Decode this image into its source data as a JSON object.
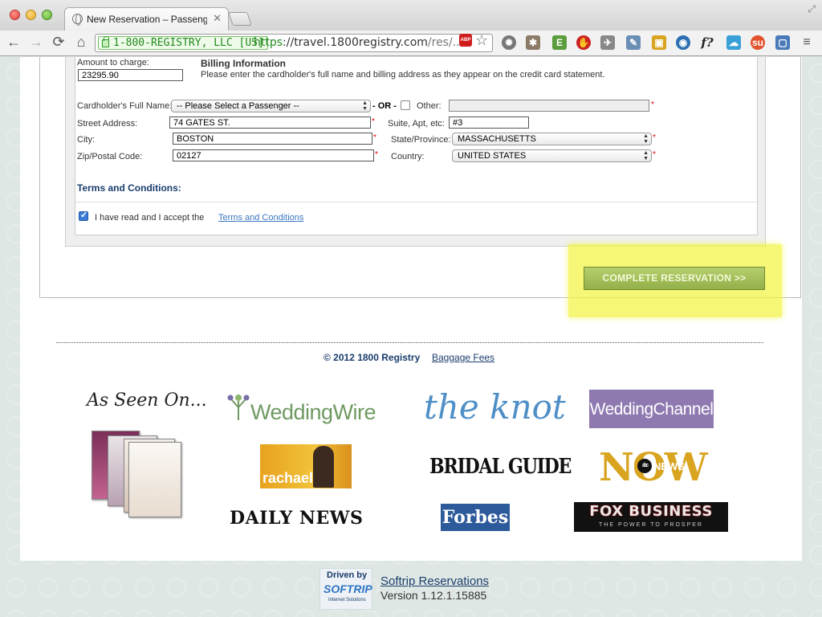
{
  "browser": {
    "tab_title": "New Reservation – Passenger",
    "tab_close": "✕",
    "ev_certificate": "1-800-REGISTRY, LLC [US]",
    "url_scheme": "https",
    "url_rest": "://travel.1800registry.com",
    "url_path": "/res/...",
    "back_icon": "←",
    "forward_icon": "→",
    "reload_icon": "⟳",
    "home_icon": "⌂",
    "bookmark_icon": "☆",
    "abp_label": "ABP"
  },
  "form": {
    "amount_label": "Amount to charge:",
    "amount_value": "23295.90",
    "billing_title": "Billing Information",
    "billing_desc": "Please enter the cardholder's full name and billing address as they appear on the credit card statement.",
    "cardholder_label": "Cardholder's Full Name:",
    "passenger_select": "-- Please Select a Passenger --",
    "or_text": "- OR -",
    "other_label": "Other:",
    "other_value": "",
    "street_label": "Street Address:",
    "street_value": "74 GATES ST.",
    "suite_label": "Suite, Apt, etc:",
    "suite_value": "#3",
    "city_label": "City:",
    "city_value": "BOSTON",
    "state_label": "State/Province:",
    "state_value": "MASSACHUSETTS",
    "zip_label": "Zip/Postal Code:",
    "zip_value": "02127",
    "country_label": "Country:",
    "country_value": "UNITED STATES",
    "required_mark": "*",
    "terms_heading": "Terms and Conditions:",
    "accept_label": "I have read and I accept the",
    "terms_link": "Terms and Conditions",
    "accept_checked": true,
    "complete_button": "COMPLETE RESERVATION >>"
  },
  "footer": {
    "copyright": "© 2012 1800 Registry",
    "baggage_link": "Baggage Fees",
    "as_seen_on": "As Seen On...",
    "logos": {
      "weddingwire": "WeddingWire",
      "theknot": "the knot",
      "weddingchannel": "WeddingChannel",
      "rachael": "rachael",
      "bridal_guide": "BRIDAL GUIDE",
      "now_abc": "abc",
      "now_news": "NEWS",
      "now": "NOW",
      "daily_news": "DAILY NEWS",
      "forbes": "Forbes",
      "fox_business": "FOX BUSINESS",
      "fox_tagline": "THE POWER TO PROSPER"
    },
    "softrip_driven_by": "Driven by",
    "softrip_logo": "SOFTRIP",
    "softrip_tagline": "Internet Solutions",
    "softrip_link": "Softrip Reservations",
    "version": "Version 1.12.1.15885"
  },
  "colors": {
    "accent_button": "#a3be5a",
    "highlight": "#f5f54a",
    "heading_blue": "#1a3d6d",
    "link_blue": "#3b78c2"
  }
}
